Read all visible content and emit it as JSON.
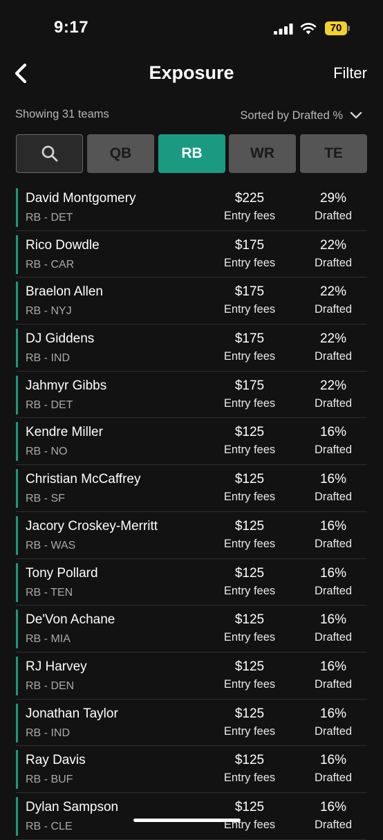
{
  "status_bar": {
    "time": "9:17",
    "battery": "70"
  },
  "nav": {
    "title": "Exposure",
    "filter_label": "Filter"
  },
  "subheader": {
    "showing": "Showing 31 teams",
    "sort_label": "Sorted by Drafted %"
  },
  "tabs": {
    "qb": "QB",
    "rb": "RB",
    "wr": "WR",
    "te": "TE",
    "active": "RB"
  },
  "colors": {
    "accent": "#1a9a80",
    "background": "#121212",
    "inactive_tab": "#555555"
  },
  "players": [
    {
      "name": "David Montgomery",
      "position": "RB - DET",
      "fee": "$225",
      "fee_label": "Entry fees",
      "pct": "29%",
      "pct_label": "Drafted"
    },
    {
      "name": "Rico Dowdle",
      "position": "RB - CAR",
      "fee": "$175",
      "fee_label": "Entry fees",
      "pct": "22%",
      "pct_label": "Drafted"
    },
    {
      "name": "Braelon Allen",
      "position": "RB - NYJ",
      "fee": "$175",
      "fee_label": "Entry fees",
      "pct": "22%",
      "pct_label": "Drafted"
    },
    {
      "name": "DJ Giddens",
      "position": "RB - IND",
      "fee": "$175",
      "fee_label": "Entry fees",
      "pct": "22%",
      "pct_label": "Drafted"
    },
    {
      "name": "Jahmyr Gibbs",
      "position": "RB - DET",
      "fee": "$175",
      "fee_label": "Entry fees",
      "pct": "22%",
      "pct_label": "Drafted"
    },
    {
      "name": "Kendre Miller",
      "position": "RB - NO",
      "fee": "$125",
      "fee_label": "Entry fees",
      "pct": "16%",
      "pct_label": "Drafted"
    },
    {
      "name": "Christian McCaffrey",
      "position": "RB - SF",
      "fee": "$125",
      "fee_label": "Entry fees",
      "pct": "16%",
      "pct_label": "Drafted"
    },
    {
      "name": "Jacory Croskey-Merritt",
      "position": "RB - WAS",
      "fee": "$125",
      "fee_label": "Entry fees",
      "pct": "16%",
      "pct_label": "Drafted"
    },
    {
      "name": "Tony Pollard",
      "position": "RB - TEN",
      "fee": "$125",
      "fee_label": "Entry fees",
      "pct": "16%",
      "pct_label": "Drafted"
    },
    {
      "name": "De'Von Achane",
      "position": "RB - MIA",
      "fee": "$125",
      "fee_label": "Entry fees",
      "pct": "16%",
      "pct_label": "Drafted"
    },
    {
      "name": "RJ Harvey",
      "position": "RB - DEN",
      "fee": "$125",
      "fee_label": "Entry fees",
      "pct": "16%",
      "pct_label": "Drafted"
    },
    {
      "name": "Jonathan Taylor",
      "position": "RB - IND",
      "fee": "$125",
      "fee_label": "Entry fees",
      "pct": "16%",
      "pct_label": "Drafted"
    },
    {
      "name": "Ray Davis",
      "position": "RB - BUF",
      "fee": "$125",
      "fee_label": "Entry fees",
      "pct": "16%",
      "pct_label": "Drafted"
    },
    {
      "name": "Dylan Sampson",
      "position": "RB - CLE",
      "fee": "$125",
      "fee_label": "Entry fees",
      "pct": "16%",
      "pct_label": "Drafted"
    }
  ]
}
